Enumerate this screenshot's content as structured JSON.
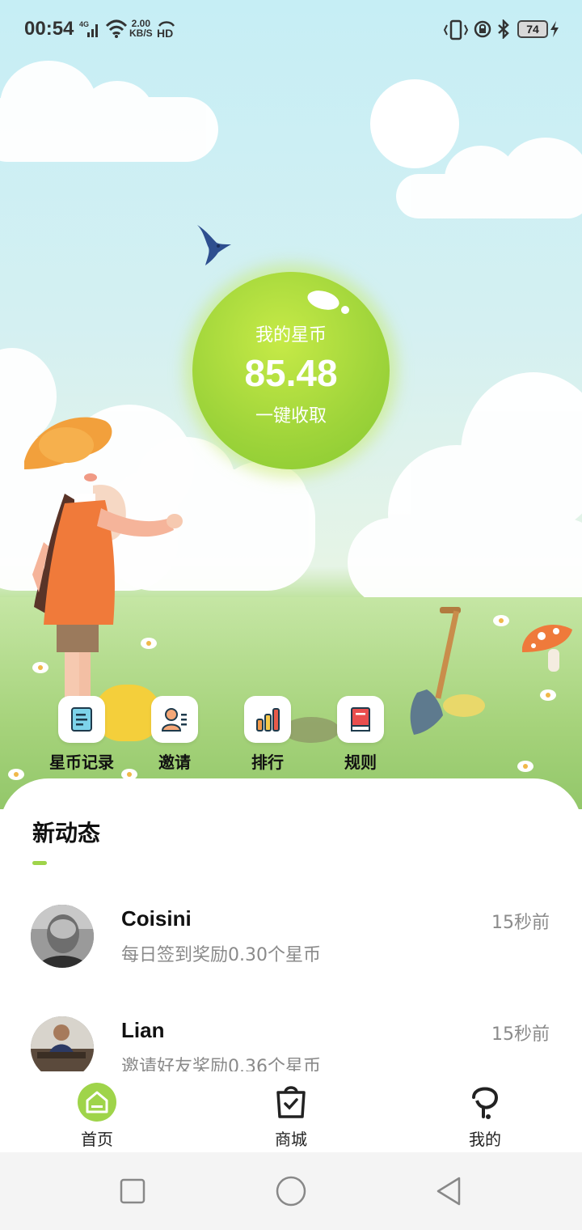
{
  "status_bar": {
    "time": "00:54",
    "network": "4G",
    "speed_value": "2.00",
    "speed_unit": "KB/S",
    "hd": "HD",
    "battery": "74"
  },
  "coin": {
    "title": "我的星币",
    "value": "85.48",
    "collect_label": "一键收取"
  },
  "actions": [
    {
      "label": "星币记录",
      "icon": "coin-record-icon"
    },
    {
      "label": "邀请",
      "icon": "invite-icon"
    },
    {
      "label": "排行",
      "icon": "ranking-icon"
    },
    {
      "label": "规则",
      "icon": "rules-book-icon"
    }
  ],
  "feed": {
    "title": "新动态",
    "items": [
      {
        "name": "Coisini",
        "time": "15秒前",
        "desc": "每日签到奖励0.30个星币"
      },
      {
        "name": "Lian",
        "time": "15秒前",
        "desc": "邀请好友奖励0.36个星币"
      }
    ]
  },
  "tabs": [
    {
      "label": "首页",
      "icon": "home-icon",
      "active": true
    },
    {
      "label": "商城",
      "icon": "shopping-bag-icon",
      "active": false
    },
    {
      "label": "我的",
      "icon": "profile-icon",
      "active": false
    }
  ],
  "colors": {
    "accent_green": "#9fd44a",
    "coin_green": "#9ed43a"
  }
}
